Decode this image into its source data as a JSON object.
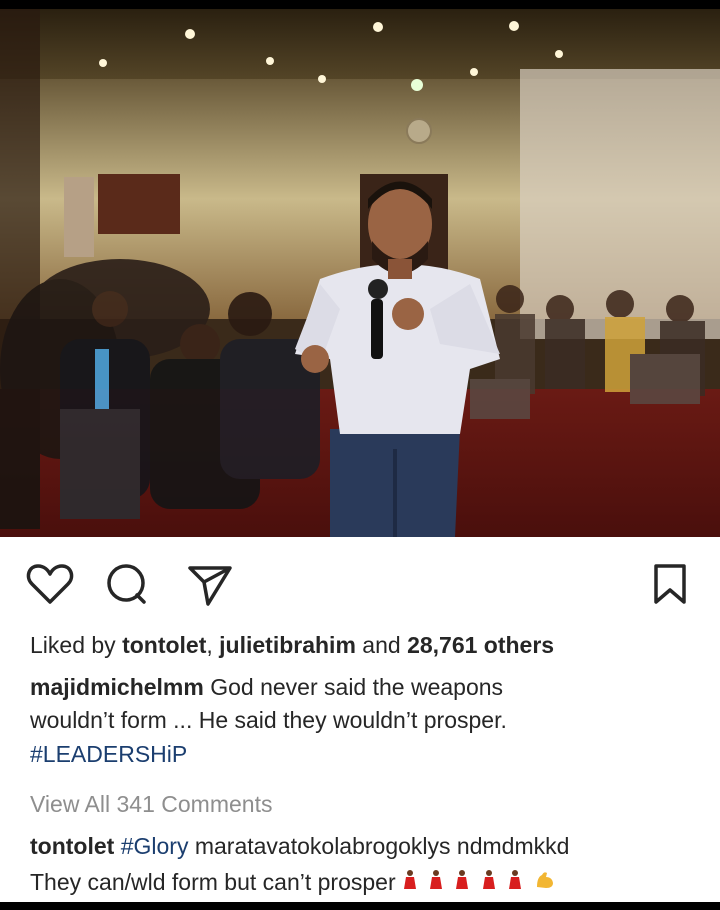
{
  "post": {
    "likes": {
      "prefix": "Liked by ",
      "user1": "tontolet",
      "separator": ", ",
      "user2": "julietibrahim",
      "middle": " and ",
      "count": "28,761 others"
    },
    "caption": {
      "username": "majidmichelmm",
      "line1_text": " God never said the weapons",
      "line2_text": "wouldn’t form ... He said they wouldn’t prosper.",
      "hashtag": "#LEADERSHiP"
    },
    "view_comments": "View All 341 Comments",
    "comment": {
      "username": "tontolet",
      "hashtag": "#Glory",
      "line1_text": " maratavatokolabrogoklys ndmdmkkd",
      "line2_text": "They can/wld form but can’t prosper",
      "emojis": [
        "woman-in-red-dress-icon",
        "woman-in-red-dress-icon",
        "woman-in-red-dress-icon",
        "woman-in-red-dress-icon",
        "woman-in-red-dress-icon",
        "flexed-biceps-icon"
      ]
    }
  },
  "colors": {
    "text": "#262626",
    "muted": "#8e8e8e",
    "hashtag": "#1b3e6f",
    "background": "#ffffff"
  }
}
